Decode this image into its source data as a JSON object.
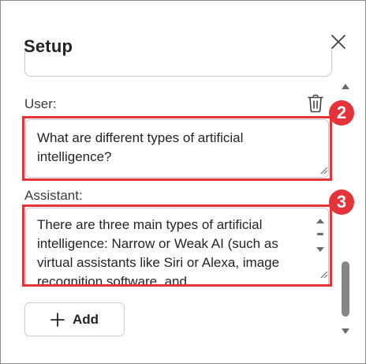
{
  "panel": {
    "title": "Setup",
    "close_icon": "close-icon"
  },
  "user": {
    "label": "User:",
    "value": "What are different types of artificial intelligence?",
    "delete_icon": "trash-icon"
  },
  "assistant": {
    "label": "Assistant:",
    "value": "There are three main types of artificial intelligence: Narrow or Weak AI (such as virtual assistants like Siri or Alexa, image recognition software, and"
  },
  "annotations": {
    "badge_user": "2",
    "badge_assistant": "3",
    "color": "#e5333a"
  },
  "add_button": {
    "label": "Add",
    "icon": "plus-icon"
  }
}
